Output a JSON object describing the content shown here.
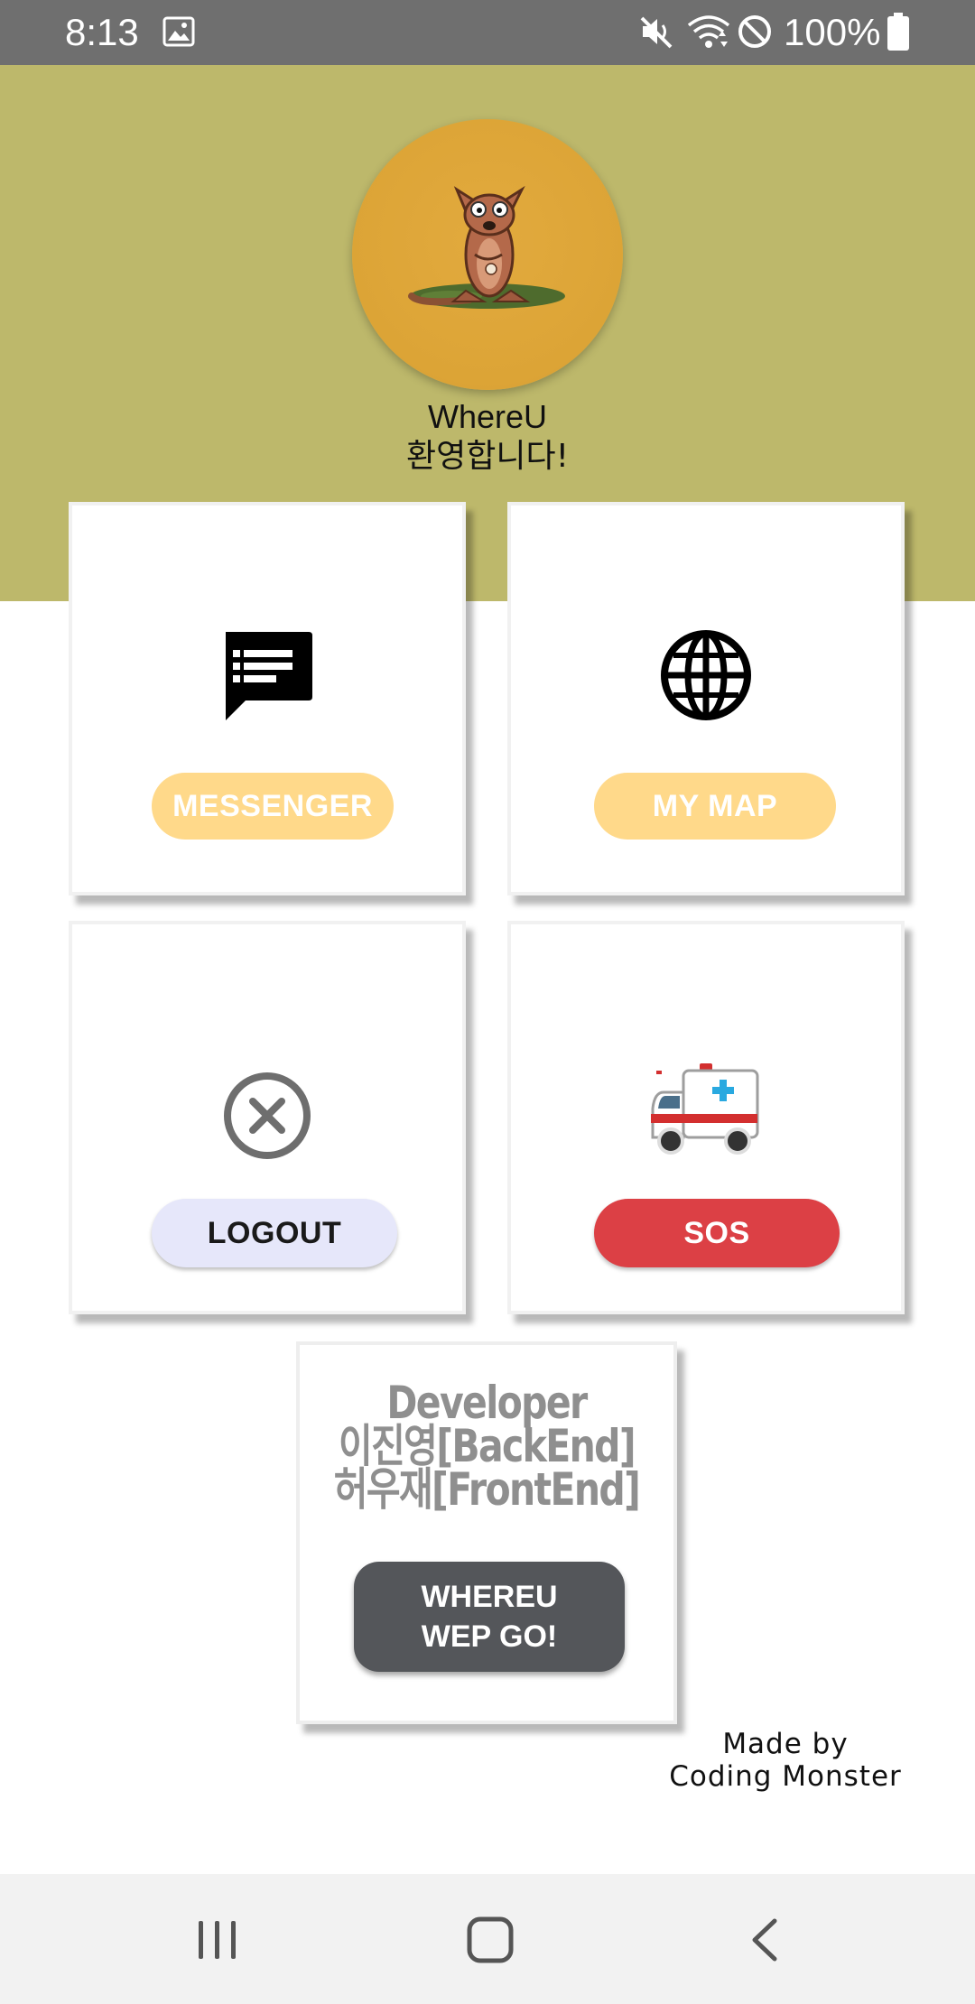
{
  "status_bar": {
    "time": "8:13",
    "battery": "100%",
    "icons": [
      "gallery-icon",
      "mute-icon",
      "wifi-icon",
      "block-icon",
      "battery-icon"
    ]
  },
  "header": {
    "background_color": "#bdb86b",
    "avatar_icon": "kangaroo-avatar",
    "app_name": "WhereU",
    "welcome": "환영합니다!"
  },
  "menu": {
    "messenger": {
      "label": "MESSENGER",
      "icon": "message-icon",
      "color": "#ffd98a"
    },
    "map": {
      "label": "MY MAP",
      "icon": "globe-icon",
      "color": "#ffd98a"
    },
    "logout": {
      "label": "LOGOUT",
      "icon": "close-circle-icon",
      "color": "#e6e7fa"
    },
    "sos": {
      "label": "SOS",
      "icon": "ambulance-icon",
      "color": "#dc4045"
    }
  },
  "developer": {
    "lines": [
      "Developer",
      "이진영[BackEnd]",
      "허우재[FrontEnd]"
    ],
    "button_line1": "WHEREU",
    "button_line2": "WEP GO!"
  },
  "credit": {
    "line1": "Made by",
    "line2": "Coding Monster"
  },
  "nav_bar": {
    "icons": [
      "recents-icon",
      "home-icon",
      "back-icon"
    ]
  }
}
